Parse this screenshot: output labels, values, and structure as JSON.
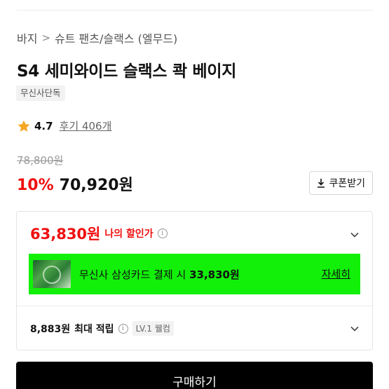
{
  "breadcrumb": {
    "items": [
      "바지",
      "슈트 팬츠/슬랙스 (엘무드)"
    ],
    "separator": ">"
  },
  "product": {
    "title": "S4 세미와이드 슬랙스 콱 베이지",
    "exclusive_badge": "무신사단독",
    "rating": {
      "score": "4.7",
      "reviews_label": "후기 406개"
    },
    "original_price": "78,800원",
    "discount_rate": "10%",
    "sale_price": "70,920원"
  },
  "coupon": {
    "label": "쿠폰받기",
    "icon": "download-icon"
  },
  "my_price": {
    "amount": "63,830원",
    "label": "나의 할인가",
    "info_glyph": "i"
  },
  "card_promo": {
    "text_prefix": "무신사 삼성카드 결제 시 ",
    "amount": "33,830원",
    "detail_label": "자세히",
    "background": "#12f00a"
  },
  "points": {
    "amount": "8,883원",
    "label": "최대 적립",
    "level_badge": "LV.1 웰컴",
    "info_glyph": "i"
  },
  "buy_button": {
    "label": "구매하기"
  },
  "colors": {
    "accent_red": "#ef1010",
    "star": "#f5a623",
    "buy_bg": "#000000"
  }
}
